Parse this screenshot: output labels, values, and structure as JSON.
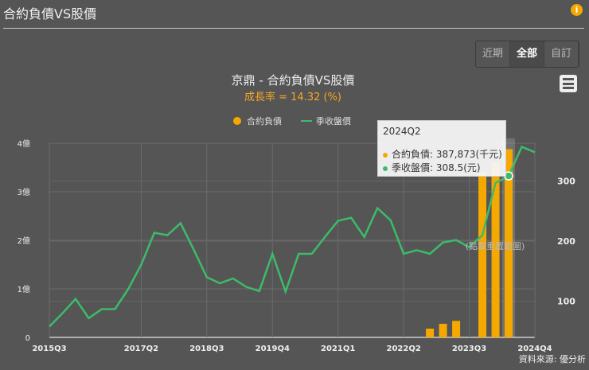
{
  "header": {
    "title": "合約負債VS股價",
    "info_icon": "i"
  },
  "range_buttons": [
    {
      "label": "近期"
    },
    {
      "label": "全部",
      "active": true
    },
    {
      "label": "自訂"
    }
  ],
  "colors": {
    "bar": "#f5a800",
    "line": "#3dbb6a",
    "growth": "#f5a623"
  },
  "reset_zoom": "(點擊重置範圍)",
  "source": "資料來源: 優分析",
  "tooltip": {
    "title": "2024Q2",
    "rows": [
      {
        "label": "合約負債: 387,873(千元)",
        "color": "#f5a800"
      },
      {
        "label": "季收盤價: 308.5(元)",
        "color": "#3dbb6a"
      }
    ]
  },
  "chart_data": {
    "type": "bar+line",
    "title": "京鼎 - 合約負債VS股價",
    "subtitle": "成長率 = 14.32 (%)",
    "legend": [
      "合約負債",
      "季收盤價"
    ],
    "legend_placement": "top-center",
    "x": [
      "2015Q3",
      "2015Q4",
      "2016Q1",
      "2016Q2",
      "2016Q3",
      "2016Q4",
      "2017Q1",
      "2017Q2",
      "2017Q3",
      "2017Q4",
      "2018Q1",
      "2018Q2",
      "2018Q3",
      "2018Q4",
      "2019Q1",
      "2019Q2",
      "2019Q3",
      "2019Q4",
      "2020Q1",
      "2020Q2",
      "2020Q3",
      "2020Q4",
      "2021Q1",
      "2021Q2",
      "2021Q3",
      "2021Q4",
      "2022Q1",
      "2022Q2",
      "2022Q3",
      "2022Q4",
      "2023Q1",
      "2023Q2",
      "2023Q3",
      "2023Q4",
      "2024Q1",
      "2024Q2",
      "2024Q3",
      "2024Q4"
    ],
    "x_ticks": [
      "2015Q3",
      "2017Q2",
      "2018Q3",
      "2019Q4",
      "2021Q1",
      "2022Q2",
      "2023Q3",
      "2024Q4"
    ],
    "series": [
      {
        "name": "合約負債",
        "type": "bar",
        "unit": "千元",
        "axis": "left",
        "values": [
          null,
          null,
          null,
          null,
          null,
          null,
          null,
          null,
          null,
          null,
          null,
          null,
          null,
          null,
          null,
          null,
          null,
          null,
          null,
          null,
          null,
          null,
          null,
          null,
          null,
          null,
          null,
          null,
          null,
          18000,
          28000,
          34000,
          null,
          340000,
          360000,
          387873,
          null,
          null
        ]
      },
      {
        "name": "季收盤價",
        "type": "line",
        "unit": "元",
        "axis": "right",
        "values": [
          58,
          80,
          104,
          72,
          87,
          87,
          120,
          161,
          214,
          210,
          230,
          186,
          140,
          130,
          138,
          124,
          117,
          179,
          116,
          179,
          179,
          207,
          234,
          239,
          207,
          255,
          235,
          179,
          185,
          179,
          198,
          202,
          190,
          210,
          297,
          308.5,
          357,
          348
        ]
      }
    ],
    "left_axis": {
      "ticks": [
        "0",
        "1億",
        "2億",
        "3億",
        "4億"
      ],
      "range": [
        0,
        400000
      ]
    },
    "right_axis": {
      "ticks": [
        "100",
        "200",
        "300"
      ],
      "range": [
        40,
        363
      ]
    },
    "grid": true
  }
}
